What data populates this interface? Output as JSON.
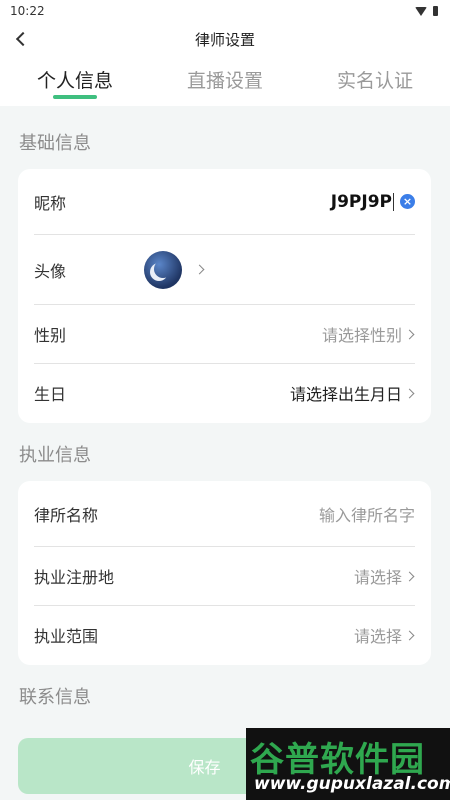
{
  "statusbar": {
    "time": "10:22"
  },
  "header": {
    "title": "律师设置"
  },
  "tabs": [
    {
      "label": "个人信息",
      "active": true
    },
    {
      "label": "直播设置",
      "active": false
    },
    {
      "label": "实名认证",
      "active": false
    }
  ],
  "sections": {
    "basic": {
      "title": "基础信息",
      "nickname": {
        "label": "昵称",
        "value": "J9PJ9P",
        "clear_icon": "×"
      },
      "avatar": {
        "label": "头像"
      },
      "gender": {
        "label": "性别",
        "placeholder": "请选择性别"
      },
      "birthday": {
        "label": "生日",
        "placeholder": "请选择出生月日"
      }
    },
    "practice": {
      "title": "执业信息",
      "firm_name": {
        "label": "律所名称",
        "placeholder": "输入律所名字"
      },
      "reg_place": {
        "label": "执业注册地",
        "placeholder": "请选择"
      },
      "scope": {
        "label": "执业范围",
        "placeholder": "请选择"
      }
    },
    "contact": {
      "title": "联系信息"
    }
  },
  "save_button": {
    "label": "保存"
  },
  "watermark": {
    "main": "谷普软件园",
    "url": "www.gupuxlazal.com"
  },
  "colors": {
    "accent": "#3fbf7f",
    "save_bg": "#b9e6c8",
    "clear": "#3b7ee8"
  }
}
